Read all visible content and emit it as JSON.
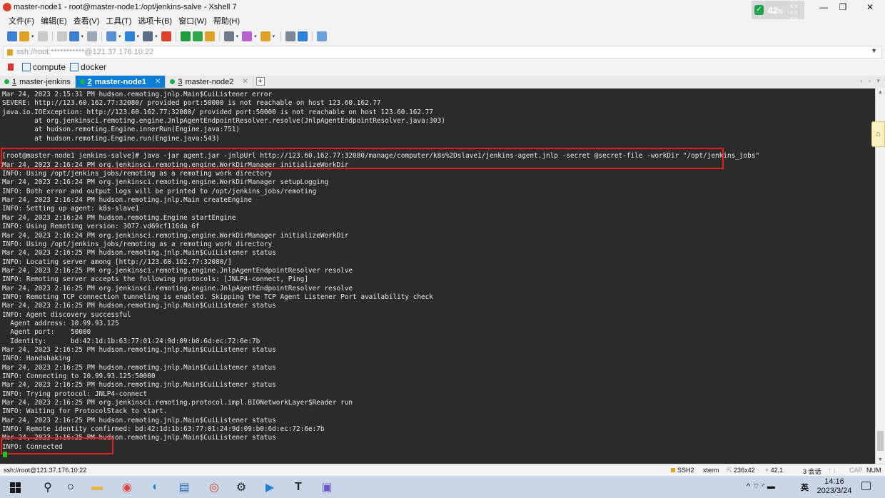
{
  "window": {
    "title": "master-node1 - root@master-node1:/opt/jenkins-salve - Xshell 7",
    "net_widget": {
      "value": "42",
      "unit": "%",
      "up_rate": "0.0 K/s",
      "down_rate": "0.0 K/s"
    },
    "controls": {
      "minimize": "—",
      "maximize": "❐",
      "close": "✕"
    }
  },
  "menu": {
    "items": [
      "文件(F)",
      "编辑(E)",
      "查看(V)",
      "工具(T)",
      "选项卡(B)",
      "窗口(W)",
      "帮助(H)"
    ]
  },
  "toolbar": {
    "icons": [
      {
        "name": "new-session-icon",
        "color": "#3d7fd1"
      },
      {
        "name": "open-folder-icon",
        "color": "#e0a32a"
      },
      {
        "name": "connect-icon",
        "color": "#c9c9c9"
      },
      {
        "name": "disconnect-icon",
        "color": "#c9c9c9"
      },
      {
        "name": "reconnect-icon",
        "color": "#3d7fd1"
      },
      {
        "name": "find-icon",
        "color": "#9aa7b5"
      },
      {
        "name": "color-scheme-icon",
        "color": "#5a8fd1"
      },
      {
        "name": "globe-icon",
        "color": "#2b82d6"
      },
      {
        "name": "font-icon",
        "color": "#5a6c85"
      },
      {
        "name": "xshell-icon",
        "color": "#d9412b"
      },
      {
        "name": "xftp-icon",
        "color": "#1f9d3c"
      },
      {
        "name": "fullscreen-icon",
        "color": "#2fa64a"
      },
      {
        "name": "lock-icon",
        "color": "#e0a32a"
      },
      {
        "name": "keyboard-icon",
        "color": "#6c7a8c"
      },
      {
        "name": "script-icon",
        "color": "#b85fd1"
      },
      {
        "name": "transfer-icon",
        "color": "#e0a32a"
      },
      {
        "name": "layout-icon",
        "color": "#7a8898"
      },
      {
        "name": "help-icon",
        "color": "#2b82d6"
      },
      {
        "name": "chat-icon",
        "color": "#6ca0dc"
      }
    ]
  },
  "address": {
    "value": "ssh://root:***********@121.37.176.10:22"
  },
  "links": {
    "items": [
      "compute",
      "docker"
    ]
  },
  "tabs": [
    {
      "number": "1",
      "label": "master-jenkins",
      "active": false
    },
    {
      "number": "2",
      "label": "master-node1",
      "active": true
    },
    {
      "number": "3",
      "label": "master-node2",
      "active": false
    }
  ],
  "tab_add_label": "+",
  "tab_nav_label": "‹ › ▾",
  "terminal": {
    "lines": [
      "Mar 24, 2023 2:15:31 PM hudson.remoting.jnlp.Main$CuiListener error",
      "SEVERE: http://123.60.162.77:32080/ provided port:50000 is not reachable on host 123.60.162.77",
      "java.io.IOException: http://123.60.162.77:32080/ provided port:50000 is not reachable on host 123.60.162.77",
      "        at org.jenkinsci.remoting.engine.JnlpAgentEndpointResolver.resolve(JnlpAgentEndpointResolver.java:303)",
      "        at hudson.remoting.Engine.innerRun(Engine.java:751)",
      "        at hudson.remoting.Engine.run(Engine.java:543)",
      "",
      "[root@master-node1 jenkins-salve]# java -jar agent.jar -jnlpUrl http://123.60.162.77:32080/manage/computer/k8s%2Dslave1/jenkins-agent.jnlp -secret @secret-file -workDir \"/opt/jenkins_jobs\"",
      "Mar 24, 2023 2:16:24 PM org.jenkinsci.remoting.engine.WorkDirManager initializeWorkDir",
      "INFO: Using /opt/jenkins_jobs/remoting as a remoting work directory",
      "Mar 24, 2023 2:16:24 PM org.jenkinsci.remoting.engine.WorkDirManager setupLogging",
      "INFO: Both error and output logs will be printed to /opt/jenkins_jobs/remoting",
      "Mar 24, 2023 2:16:24 PM hudson.remoting.jnlp.Main createEngine",
      "INFO: Setting up agent: k8s-slave1",
      "Mar 24, 2023 2:16:24 PM hudson.remoting.Engine startEngine",
      "INFO: Using Remoting version: 3077.vd69cf116da_6f",
      "Mar 24, 2023 2:16:24 PM org.jenkinsci.remoting.engine.WorkDirManager initializeWorkDir",
      "INFO: Using /opt/jenkins_jobs/remoting as a remoting work directory",
      "Mar 24, 2023 2:16:25 PM hudson.remoting.jnlp.Main$CuiListener status",
      "INFO: Locating server among [http://123.60.162.77:32080/]",
      "Mar 24, 2023 2:16:25 PM org.jenkinsci.remoting.engine.JnlpAgentEndpointResolver resolve",
      "INFO: Remoting server accepts the following protocols: [JNLP4-connect, Ping]",
      "Mar 24, 2023 2:16:25 PM org.jenkinsci.remoting.engine.JnlpAgentEndpointResolver resolve",
      "INFO: Remoting TCP connection tunneling is enabled. Skipping the TCP Agent Listener Port availability check",
      "Mar 24, 2023 2:16:25 PM hudson.remoting.jnlp.Main$CuiListener status",
      "INFO: Agent discovery successful",
      "  Agent address: 10.99.93.125",
      "  Agent port:    50000",
      "  Identity:      bd:42:1d:1b:63:77:01:24:9d:09:b0:6d:ec:72:6e:7b",
      "Mar 24, 2023 2:16:25 PM hudson.remoting.jnlp.Main$CuiListener status",
      "INFO: Handshaking",
      "Mar 24, 2023 2:16:25 PM hudson.remoting.jnlp.Main$CuiListener status",
      "INFO: Connecting to 10.99.93.125:50000",
      "Mar 24, 2023 2:16:25 PM hudson.remoting.jnlp.Main$CuiListener status",
      "INFO: Trying protocol: JNLP4-connect",
      "Mar 24, 2023 2:16:25 PM org.jenkinsci.remoting.protocol.impl.BIONetworkLayer$Reader run",
      "INFO: Waiting for ProtocolStack to start.",
      "Mar 24, 2023 2:16:25 PM hudson.remoting.jnlp.Main$CuiListener status",
      "INFO: Remote identity confirmed: bd:42:1d:1b:63:77:01:24:9d:09:b0:6d:ec:72:6e:7b",
      "Mar 24, 2023 2:16:25 PM hudson.remoting.jnlp.Main$CuiListener status",
      "INFO: Connected"
    ]
  },
  "statusbar": {
    "address": "ssh://root@121.37.176.10:22",
    "protocol": "SSH2",
    "terminal_type": "xterm",
    "size": "236x42",
    "cursor_pos": "42,1",
    "sessions": "3 会话",
    "caps": "CAP",
    "num": "NUM"
  },
  "taskbar": {
    "apps": [
      {
        "name": "search-icon",
        "glyph": "⚲",
        "color": "#111"
      },
      {
        "name": "cortana-icon",
        "glyph": "○",
        "color": "#111"
      },
      {
        "name": "file-explorer-icon",
        "glyph": "▬",
        "color": "#e8b540"
      },
      {
        "name": "chrome-icon",
        "glyph": "◉",
        "color": "#db4437"
      },
      {
        "name": "edge-icon",
        "glyph": "◐",
        "color": "#1a8bc9"
      },
      {
        "name": "docs-icon",
        "glyph": "▤",
        "color": "#2b6cc4"
      },
      {
        "name": "xshell-icon",
        "glyph": "◎",
        "color": "#d9412b"
      },
      {
        "name": "settings-icon",
        "glyph": "⚙",
        "color": "#222"
      },
      {
        "name": "vscode-icon",
        "glyph": "▶",
        "color": "#2a7fd4"
      },
      {
        "name": "typora-icon",
        "glyph": "T",
        "color": "#222"
      },
      {
        "name": "photo-icon",
        "glyph": "▣",
        "color": "#6d5ac9"
      }
    ],
    "tray_label": "^ ⌔ ◜ ▬",
    "ime": "英",
    "time": "14:16",
    "date": "2023/3/24"
  }
}
